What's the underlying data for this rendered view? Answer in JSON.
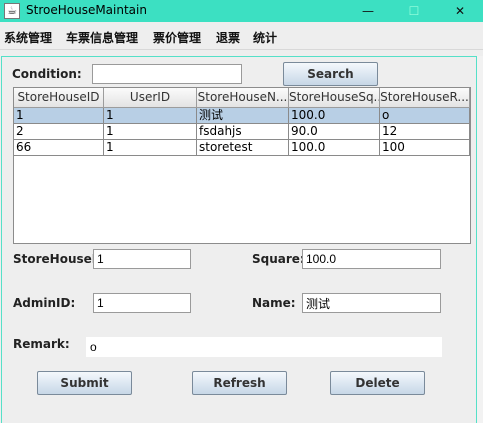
{
  "window": {
    "title": "StroeHouseMaintain",
    "app_icon": "java-coffee-icon",
    "controls": {
      "minimize": "—",
      "maximize": "☐",
      "close": "✕"
    }
  },
  "menubar": {
    "items": [
      "系统管理",
      "车票信息管理",
      "票价管理",
      "退票",
      "统计"
    ]
  },
  "search": {
    "label": "Condition:",
    "value": "",
    "button": "Search"
  },
  "table": {
    "headers": [
      "StoreHouseID",
      "UserID",
      "StoreHouseN...",
      "StoreHouseSq...",
      "StoreHouseR..."
    ],
    "rows": [
      [
        "1",
        "1",
        "测试",
        "100.0",
        "o"
      ],
      [
        "2",
        "1",
        "fsdahjs",
        "90.0",
        "12"
      ],
      [
        "66",
        "1",
        "storetest",
        "100.0",
        "100"
      ]
    ],
    "selected_row": 0
  },
  "form": {
    "storehouse_id_label": "StoreHouseI...",
    "storehouse_id_value": "1",
    "square_label": "Square:",
    "square_value": "100.0",
    "admin_id_label": "AdminID:",
    "admin_id_value": "1",
    "name_label": "Name:",
    "name_value": "测试",
    "remark_label": "Remark:",
    "remark_value": "o"
  },
  "buttons": {
    "submit": "Submit",
    "refresh": "Refresh",
    "delete": "Delete"
  },
  "colors": {
    "titlebar": "#3ce0c2",
    "selection": "#b8cfe5",
    "panel_border": "#55e0c8"
  }
}
